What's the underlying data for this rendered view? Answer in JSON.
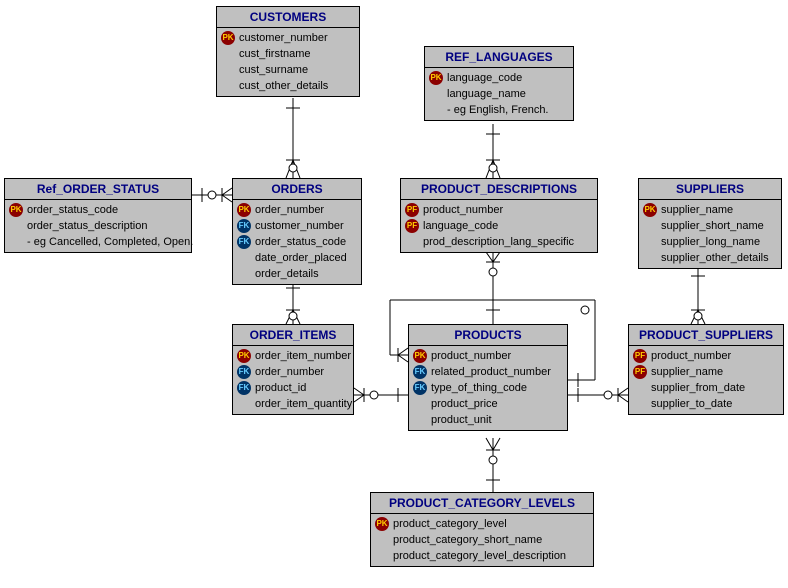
{
  "entities": {
    "customers": {
      "title": "CUSTOMERS",
      "attrs": [
        {
          "key": "PK",
          "name": "customer_number"
        },
        {
          "key": "",
          "name": "cust_firstname"
        },
        {
          "key": "",
          "name": "cust_surname"
        },
        {
          "key": "",
          "name": "cust_other_details"
        }
      ]
    },
    "ref_languages": {
      "title": "REF_LANGUAGES",
      "attrs": [
        {
          "key": "PK",
          "name": "language_code"
        },
        {
          "key": "",
          "name": "language_name"
        },
        {
          "key": "",
          "name": "- eg English, French."
        }
      ]
    },
    "ref_order_status": {
      "title": "Ref_ORDER_STATUS",
      "attrs": [
        {
          "key": "PK",
          "name": "order_status_code"
        },
        {
          "key": "",
          "name": "order_status_description"
        },
        {
          "key": "",
          "name": "- eg Cancelled, Completed, Open."
        }
      ]
    },
    "orders": {
      "title": "ORDERS",
      "attrs": [
        {
          "key": "PK",
          "name": "order_number"
        },
        {
          "key": "FK",
          "name": "customer_number"
        },
        {
          "key": "FK",
          "name": "order_status_code"
        },
        {
          "key": "",
          "name": "date_order_placed"
        },
        {
          "key": "",
          "name": "order_details"
        }
      ]
    },
    "product_descriptions": {
      "title": "PRODUCT_DESCRIPTIONS",
      "attrs": [
        {
          "key": "PF",
          "name": "product_number"
        },
        {
          "key": "PF",
          "name": "language_code"
        },
        {
          "key": "",
          "name": "prod_description_lang_specific"
        }
      ]
    },
    "suppliers": {
      "title": "SUPPLIERS",
      "attrs": [
        {
          "key": "PK",
          "name": "supplier_name"
        },
        {
          "key": "",
          "name": "supplier_short_name"
        },
        {
          "key": "",
          "name": "supplier_long_name"
        },
        {
          "key": "",
          "name": "supplier_other_details"
        }
      ]
    },
    "order_items": {
      "title": "ORDER_ITEMS",
      "attrs": [
        {
          "key": "PK",
          "name": "order_item_number"
        },
        {
          "key": "FK",
          "name": "order_number"
        },
        {
          "key": "FK",
          "name": "product_id"
        },
        {
          "key": "",
          "name": "order_item_quantity"
        }
      ]
    },
    "products": {
      "title": "PRODUCTS",
      "attrs": [
        {
          "key": "PK",
          "name": "product_number"
        },
        {
          "key": "FK",
          "name": "related_product_number"
        },
        {
          "key": "FK",
          "name": "type_of_thing_code"
        },
        {
          "key": "",
          "name": "product_price"
        },
        {
          "key": "",
          "name": "product_unit"
        }
      ]
    },
    "product_suppliers": {
      "title": "PRODUCT_SUPPLIERS",
      "attrs": [
        {
          "key": "PF",
          "name": "product_number"
        },
        {
          "key": "PF",
          "name": "supplier_name"
        },
        {
          "key": "",
          "name": "supplier_from_date"
        },
        {
          "key": "",
          "name": "supplier_to_date"
        }
      ]
    },
    "product_category_levels": {
      "title": "PRODUCT_CATEGORY_LEVELS",
      "attrs": [
        {
          "key": "PK",
          "name": "product_category_level"
        },
        {
          "key": "",
          "name": "product_category_short_name"
        },
        {
          "key": "",
          "name": "product_category_level_description"
        }
      ]
    }
  }
}
